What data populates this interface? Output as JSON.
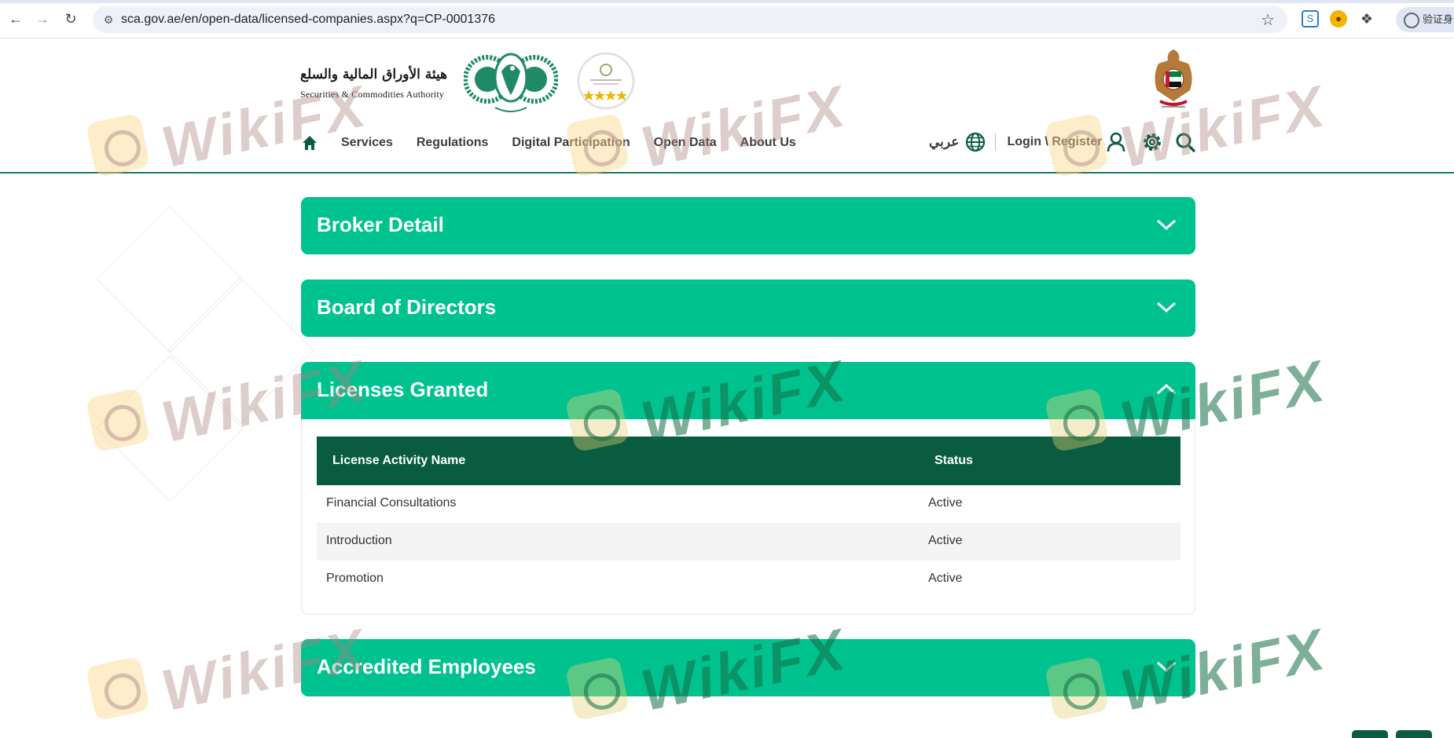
{
  "browser": {
    "url": "sca.gov.ae/en/open-data/licensed-companies.aspx?q=CP-0001376",
    "profile_label": "验证身"
  },
  "header": {
    "logo_ar": "هيئة الأوراق المالية والسلع",
    "logo_en": "Securities & Commodities Authority",
    "nav": [
      "Services",
      "Regulations",
      "Digital Participation",
      "Open Data",
      "About Us"
    ],
    "language_label": "عربي",
    "login_label": "Login \\ Register"
  },
  "sections": {
    "broker_detail": "Broker Detail",
    "board_of_directors": "Board of Directors",
    "licenses_granted": "Licenses Granted",
    "accredited_employees": "Accredited Employees"
  },
  "licenses_table": {
    "headers": [
      "License Activity Name",
      "Status"
    ],
    "rows": [
      [
        "Financial Consultations",
        "Active"
      ],
      [
        "Introduction",
        "Active"
      ],
      [
        "Promotion",
        "Active"
      ]
    ]
  },
  "watermark": {
    "text": "WikiFX"
  },
  "colors": {
    "accordion_green": "#00c28f",
    "table_header": "#0a5c40",
    "brand_dark_green": "#1c7a5a"
  }
}
